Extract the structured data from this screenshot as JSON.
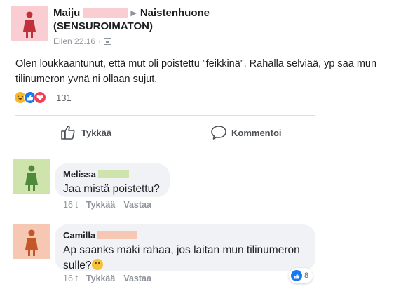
{
  "post": {
    "author": "Maiju",
    "group": "Naistenhuone",
    "group_suffix": "(SENSUROIMATON)",
    "time": "Eilen 22.16",
    "separator": "·",
    "text": "Olen loukkaantunut, että mut oli poistettu ”feikkinä”. Rahalla selviää, yp saa mun tilinumeron yvnä ni ollaan sujut.",
    "reaction_count": "131",
    "avatar_color": "#f9cdd2"
  },
  "actions": {
    "like_label": "Tykkää",
    "comment_label": "Kommentoi"
  },
  "comments": [
    {
      "author": "Melissa",
      "text": "Jaa mistä poistettu?",
      "time": "16 t",
      "like_label": "Tykkää",
      "reply_label": "Vastaa",
      "avatar_color": "#cfe3ad"
    },
    {
      "author": "Camilla",
      "text": "Ap saanks mäki rahaa, jos laitan mun tilinumeron sulle?",
      "time": "16 t",
      "like_label": "Tykkää",
      "reply_label": "Vastaa",
      "likes": "8",
      "avatar_color": "#f6c7b2"
    }
  ]
}
